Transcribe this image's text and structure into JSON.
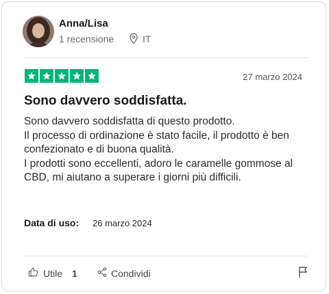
{
  "reviewer": {
    "name": "Anna/Lisa",
    "review_count": "1 recensione",
    "country": "IT"
  },
  "review": {
    "rating": 5,
    "date": "27 marzo 2024",
    "title": "Sono davvero soddisfatta.",
    "body_lines": [
      "Sono davvero soddisfatta di questo prodotto.",
      "Il processo di ordinazione è stato facile, il prodotto è ben confezionato e di buona qualità.",
      "I prodotti sono eccellenti, adoro le caramelle gommose al CBD, mi aiutano a superare i giorni più difficili."
    ],
    "usage_label": "Data di uso:",
    "usage_date": "26 marzo 2024"
  },
  "actions": {
    "useful_label": "Utile",
    "useful_count": "1",
    "share_label": "Condividi"
  },
  "colors": {
    "star": "#00b67a",
    "text": "#191919",
    "muted": "#6b6b6b"
  },
  "icons": {
    "location": "map-pin-icon",
    "useful": "thumbs-up-icon",
    "share": "share-icon",
    "report": "flag-icon"
  }
}
